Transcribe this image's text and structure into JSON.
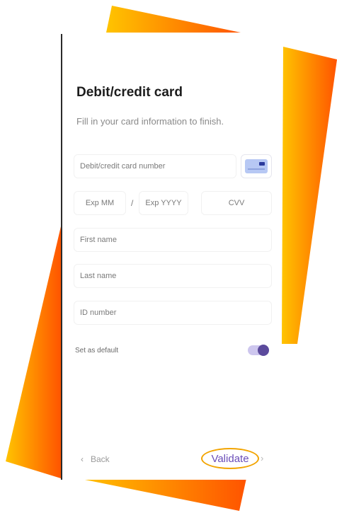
{
  "form": {
    "title": "Debit/credit card",
    "subtitle": "Fill in your card information to finish."
  },
  "fields": {
    "card_number_placeholder": "Debit/credit card number",
    "exp_month_placeholder": "Exp MM",
    "separator": "/",
    "exp_year_placeholder": "Exp YYYY",
    "cvv_placeholder": "CVV",
    "first_name_placeholder": "First name",
    "last_name_placeholder": "Last name",
    "id_number_placeholder": "ID number"
  },
  "default_setting": {
    "label": "Set as default",
    "enabled": true
  },
  "footer": {
    "back_label": "Back",
    "back_icon": "chevron-left-icon",
    "validate_label": "Validate",
    "validate_icon": "chevron-right-icon"
  },
  "colors": {
    "accent": "#5b4a9c",
    "highlight": "#f2a400",
    "gradient_start": "#ffbf00",
    "gradient_end": "#ff5a00"
  }
}
